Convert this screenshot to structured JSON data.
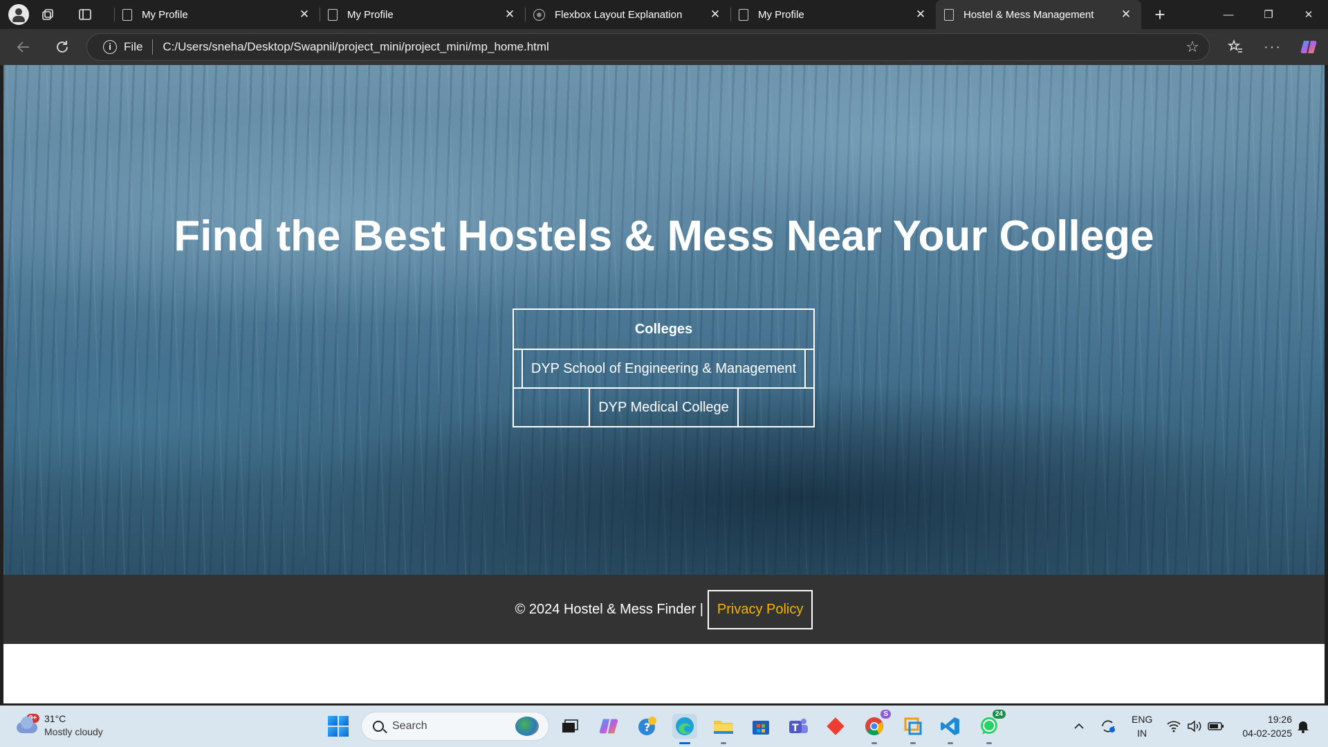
{
  "browser": {
    "tabs": [
      {
        "title": "My Profile",
        "active": false,
        "favicon": "page-icon"
      },
      {
        "title": "My Profile",
        "active": false,
        "favicon": "page-icon"
      },
      {
        "title": "Flexbox Layout Explanation",
        "active": false,
        "favicon": "globe-icon"
      },
      {
        "title": "My Profile",
        "active": false,
        "favicon": "page-icon"
      },
      {
        "title": "Hostel & Mess Management",
        "active": true,
        "favicon": "page-icon"
      }
    ],
    "address": {
      "scheme_label": "File",
      "url": "C:/Users/sneha/Desktop/Swapnil/project_mini/project_mini/mp_home.html"
    }
  },
  "page": {
    "hero_title": "Find the Best Hostels & Mess Near Your College",
    "colleges": {
      "heading": "Colleges",
      "items": [
        "DYP School of Engineering & Management",
        "DYP Medical College"
      ]
    },
    "footer": {
      "copyright": "© 2024 Hostel & Mess Finder |",
      "privacy_link": "Privacy Policy",
      "link_color": "#f5b400"
    }
  },
  "taskbar": {
    "weather": {
      "temp": "31°C",
      "condition": "Mostly cloudy",
      "badge": "9+"
    },
    "search_placeholder": "Search",
    "whatsapp_badge": "24",
    "chrome_badge": "S",
    "language": {
      "line1": "ENG",
      "line2": "IN"
    },
    "time": "19:26",
    "date": "04-02-2025"
  }
}
